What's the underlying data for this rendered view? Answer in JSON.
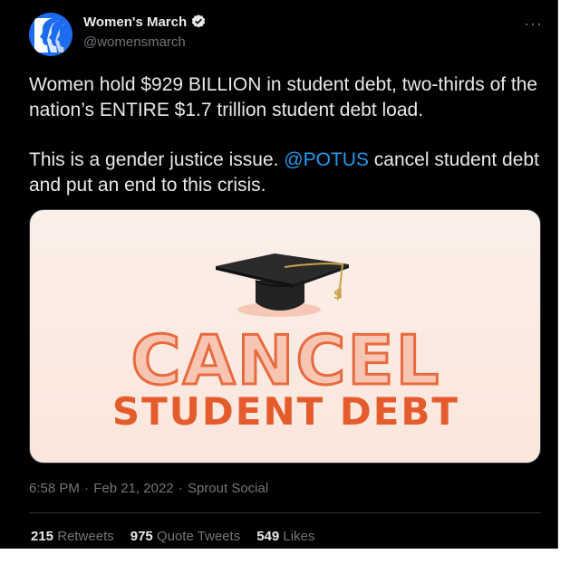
{
  "author": {
    "display_name": "Women's March",
    "handle": "@womensmarch",
    "verified_icon": "verified-badge-icon",
    "avatar_color": "#1d6cf0"
  },
  "more_menu": "···",
  "tweet": {
    "paragraph1": "Women hold $929 BILLION in student debt, two-thirds of the nation’s ENTIRE $1.7 trillion student debt load.",
    "paragraph2_before": "This is a gender justice issue. ",
    "mention": "@POTUS",
    "paragraph2_after": " cancel student debt and put an end to this crisis."
  },
  "media": {
    "headline": "CANCEL",
    "subheadline": "STUDENT DEBT",
    "cap_icon": "graduation-cap-icon",
    "tassel_glyph": "$",
    "accent_color": "#e55c2c"
  },
  "meta": {
    "time": "6:58 PM",
    "separator": "·",
    "date": "Feb 21, 2022",
    "source": "Sprout Social"
  },
  "stats": {
    "retweets_count": "215",
    "retweets_label": "Retweets",
    "quotes_count": "975",
    "quotes_label": "Quote Tweets",
    "likes_count": "549",
    "likes_label": "Likes"
  },
  "colors": {
    "background": "#000000",
    "text": "#e7e9ea",
    "muted": "#71767b",
    "link": "#1d9bf0",
    "border": "#2f3336"
  }
}
